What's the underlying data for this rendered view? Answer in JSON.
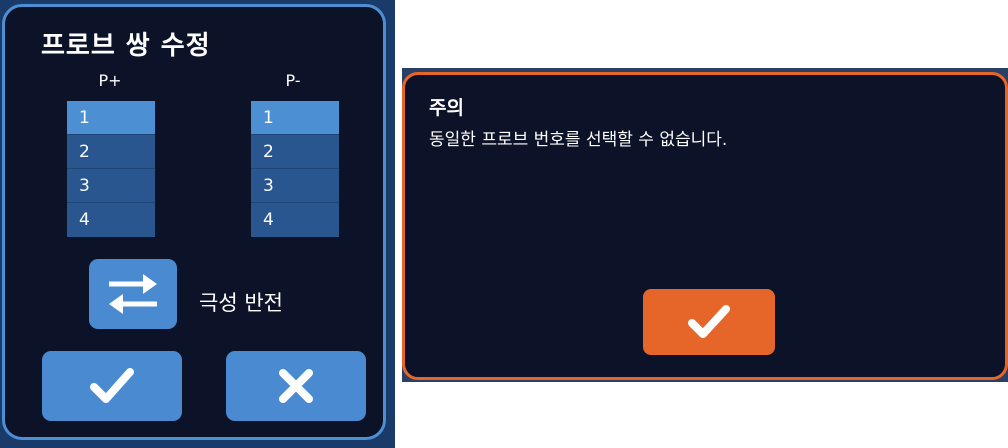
{
  "probe_dialog": {
    "title": "프로브 쌍 수정",
    "p_plus": {
      "header": "P+",
      "items": [
        "1",
        "2",
        "3",
        "4"
      ],
      "selected": "1"
    },
    "p_minus": {
      "header": "P-",
      "items": [
        "1",
        "2",
        "3",
        "4"
      ],
      "selected": "1"
    },
    "swap_label": "극성 반전",
    "confirm_icon": "checkmark-icon",
    "cancel_icon": "x-icon",
    "swap_icon": "swap-arrows-icon",
    "colors": {
      "border": "#4d8fd3",
      "button": "#4a8ad0",
      "background": "#0c1328",
      "selected_item": "#4d8fd3",
      "item": "#2a5690"
    }
  },
  "warning_dialog": {
    "title": "주의",
    "message": "동일한 프로브 번호를 선택할 수 없습니다.",
    "confirm_icon": "checkmark-icon",
    "colors": {
      "border": "#e6662a",
      "button": "#e6662a",
      "background": "#0c1328"
    }
  }
}
